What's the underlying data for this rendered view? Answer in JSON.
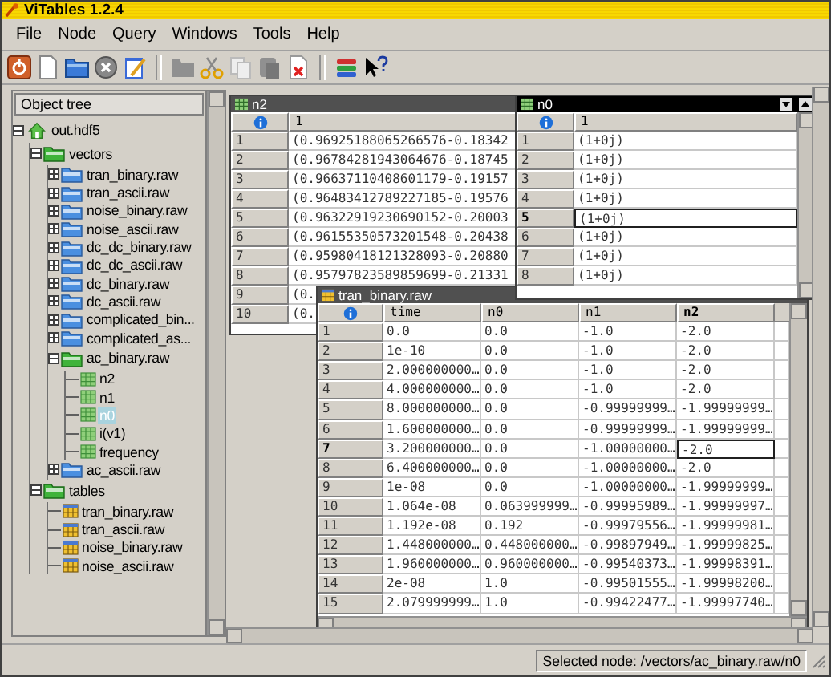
{
  "window": {
    "title": "ViTables 1.2.4"
  },
  "menu": [
    "File",
    "Node",
    "Query",
    "Windows",
    "Tools",
    "Help"
  ],
  "dock": {
    "title": "Object tree",
    "tree": [
      {
        "label": "out.hdf5",
        "kind": "file",
        "expanded": true,
        "selected": false,
        "children": [
          {
            "label": "vectors",
            "kind": "group",
            "expanded": true,
            "selected": false,
            "children": [
              {
                "label": "tran_binary.raw",
                "kind": "group",
                "expanded": false,
                "selected": false
              },
              {
                "label": "tran_ascii.raw",
                "kind": "group",
                "expanded": false,
                "selected": false
              },
              {
                "label": "noise_binary.raw",
                "kind": "group",
                "expanded": false,
                "selected": false
              },
              {
                "label": "noise_ascii.raw",
                "kind": "group",
                "expanded": false,
                "selected": false
              },
              {
                "label": "dc_dc_binary.raw",
                "kind": "group",
                "expanded": false,
                "selected": false
              },
              {
                "label": "dc_dc_ascii.raw",
                "kind": "group",
                "expanded": false,
                "selected": false
              },
              {
                "label": "dc_binary.raw",
                "kind": "group",
                "expanded": false,
                "selected": false
              },
              {
                "label": "dc_ascii.raw",
                "kind": "group",
                "expanded": false,
                "selected": false
              },
              {
                "label": "complicated_bin...",
                "kind": "group",
                "expanded": false,
                "selected": false
              },
              {
                "label": "complicated_as...",
                "kind": "group",
                "expanded": false,
                "selected": false
              },
              {
                "label": "ac_binary.raw",
                "kind": "group",
                "expanded": true,
                "selected": false,
                "children": [
                  {
                    "label": "n2",
                    "kind": "array",
                    "selected": false
                  },
                  {
                    "label": "n1",
                    "kind": "array",
                    "selected": false
                  },
                  {
                    "label": "n0",
                    "kind": "array",
                    "selected": true
                  },
                  {
                    "label": "i(v1)",
                    "kind": "array",
                    "selected": false
                  },
                  {
                    "label": "frequency",
                    "kind": "array",
                    "selected": false
                  }
                ]
              },
              {
                "label": "ac_ascii.raw",
                "kind": "group",
                "expanded": false,
                "selected": false
              }
            ]
          },
          {
            "label": "tables",
            "kind": "group",
            "expanded": true,
            "selected": false,
            "children": [
              {
                "label": "tran_binary.raw",
                "kind": "table",
                "selected": false
              },
              {
                "label": "tran_ascii.raw",
                "kind": "table",
                "selected": false
              },
              {
                "label": "noise_binary.raw",
                "kind": "table",
                "selected": false
              },
              {
                "label": "noise_ascii.raw",
                "kind": "table",
                "selected": false
              }
            ]
          }
        ]
      }
    ]
  },
  "windows": [
    {
      "kind": "array",
      "title": "n2",
      "active": false,
      "columns": [
        {
          "label": "1",
          "current": false
        }
      ],
      "rows": [
        {
          "label": "1",
          "current": false,
          "cells": [
            "(0.96925188065266576-0.18342"
          ]
        },
        {
          "label": "2",
          "current": false,
          "cells": [
            "(0.96784281943064676-0.18745"
          ]
        },
        {
          "label": "3",
          "current": false,
          "cells": [
            "(0.96637110408601179-0.19157"
          ]
        },
        {
          "label": "4",
          "current": false,
          "cells": [
            "(0.96483412789227185-0.19576"
          ]
        },
        {
          "label": "5",
          "current": false,
          "cells": [
            "(0.96322919230690152-0.20003"
          ]
        },
        {
          "label": "6",
          "current": false,
          "cells": [
            "(0.96155350573201548-0.20438"
          ]
        },
        {
          "label": "7",
          "current": false,
          "cells": [
            "(0.95980418121328093-0.20880"
          ]
        },
        {
          "label": "8",
          "current": false,
          "cells": [
            "(0.95797823589859699-0.21331"
          ]
        },
        {
          "label": "9",
          "current": false,
          "cells": [
            "(0."
          ]
        },
        {
          "label": "10",
          "current": false,
          "cells": [
            "(0."
          ]
        }
      ]
    },
    {
      "kind": "array",
      "title": "n0",
      "active": true,
      "columns": [
        {
          "label": "1",
          "current": false
        }
      ],
      "rows": [
        {
          "label": "1",
          "current": false,
          "cells": [
            "(1+0j)"
          ]
        },
        {
          "label": "2",
          "current": false,
          "cells": [
            "(1+0j)"
          ]
        },
        {
          "label": "3",
          "current": false,
          "cells": [
            "(1+0j)"
          ]
        },
        {
          "label": "4",
          "current": false,
          "cells": [
            "(1+0j)"
          ]
        },
        {
          "label": "5",
          "current": true,
          "cells": [
            "(1+0j)"
          ]
        },
        {
          "label": "6",
          "current": false,
          "cells": [
            "(1+0j)"
          ]
        },
        {
          "label": "7",
          "current": false,
          "cells": [
            "(1+0j)"
          ]
        },
        {
          "label": "8",
          "current": false,
          "cells": [
            "(1+0j)"
          ]
        }
      ]
    },
    {
      "kind": "table",
      "title": "tran_binary.raw",
      "active": false,
      "columns": [
        {
          "label": "time",
          "current": false
        },
        {
          "label": "n0",
          "current": false
        },
        {
          "label": "n1",
          "current": false
        },
        {
          "label": "n2",
          "current": true
        }
      ],
      "rows": [
        {
          "label": "1",
          "current": false,
          "cells": [
            "0.0",
            "0.0",
            "-1.0",
            "-2.0"
          ]
        },
        {
          "label": "2",
          "current": false,
          "cells": [
            "1e-10",
            "0.0",
            "-1.0",
            "-2.0"
          ]
        },
        {
          "label": "3",
          "current": false,
          "cells": [
            "2.000000000…",
            "0.0",
            "-1.0",
            "-2.0"
          ]
        },
        {
          "label": "4",
          "current": false,
          "cells": [
            "4.000000000…",
            "0.0",
            "-1.0",
            "-2.0"
          ]
        },
        {
          "label": "5",
          "current": false,
          "cells": [
            "8.000000000…",
            "0.0",
            "-0.99999999…",
            "-1.99999999…"
          ]
        },
        {
          "label": "6",
          "current": false,
          "cells": [
            "1.600000000…",
            "0.0",
            "-0.99999999…",
            "-1.99999999…"
          ]
        },
        {
          "label": "7",
          "current": true,
          "cells": [
            "3.200000000…",
            "0.0",
            "-1.00000000…",
            "-2.0"
          ]
        },
        {
          "label": "8",
          "current": false,
          "cells": [
            "6.400000000…",
            "0.0",
            "-1.00000000…",
            "-2.0"
          ]
        },
        {
          "label": "9",
          "current": false,
          "cells": [
            "1e-08",
            "0.0",
            "-1.00000000…",
            "-1.99999999…"
          ]
        },
        {
          "label": "10",
          "current": false,
          "cells": [
            "1.064e-08",
            "0.063999999…",
            "-0.99995989…",
            "-1.99999997…"
          ]
        },
        {
          "label": "11",
          "current": false,
          "cells": [
            "1.192e-08",
            "0.192",
            "-0.99979556…",
            "-1.99999981…"
          ]
        },
        {
          "label": "12",
          "current": false,
          "cells": [
            "1.448000000…",
            "0.448000000…",
            "-0.99897949…",
            "-1.99999825…"
          ]
        },
        {
          "label": "13",
          "current": false,
          "cells": [
            "1.960000000…",
            "0.960000000…",
            "-0.99540373…",
            "-1.99998391…"
          ]
        },
        {
          "label": "14",
          "current": false,
          "cells": [
            "2e-08",
            "1.0",
            "-0.99501555…",
            "-1.99998200…"
          ]
        },
        {
          "label": "15",
          "current": false,
          "cells": [
            "2.079999999…",
            "1.0",
            "-0.99422477…",
            "-1.99997740…"
          ]
        }
      ]
    }
  ],
  "status_bar": "Selected node: /vectors/ac_binary.raw/n0"
}
